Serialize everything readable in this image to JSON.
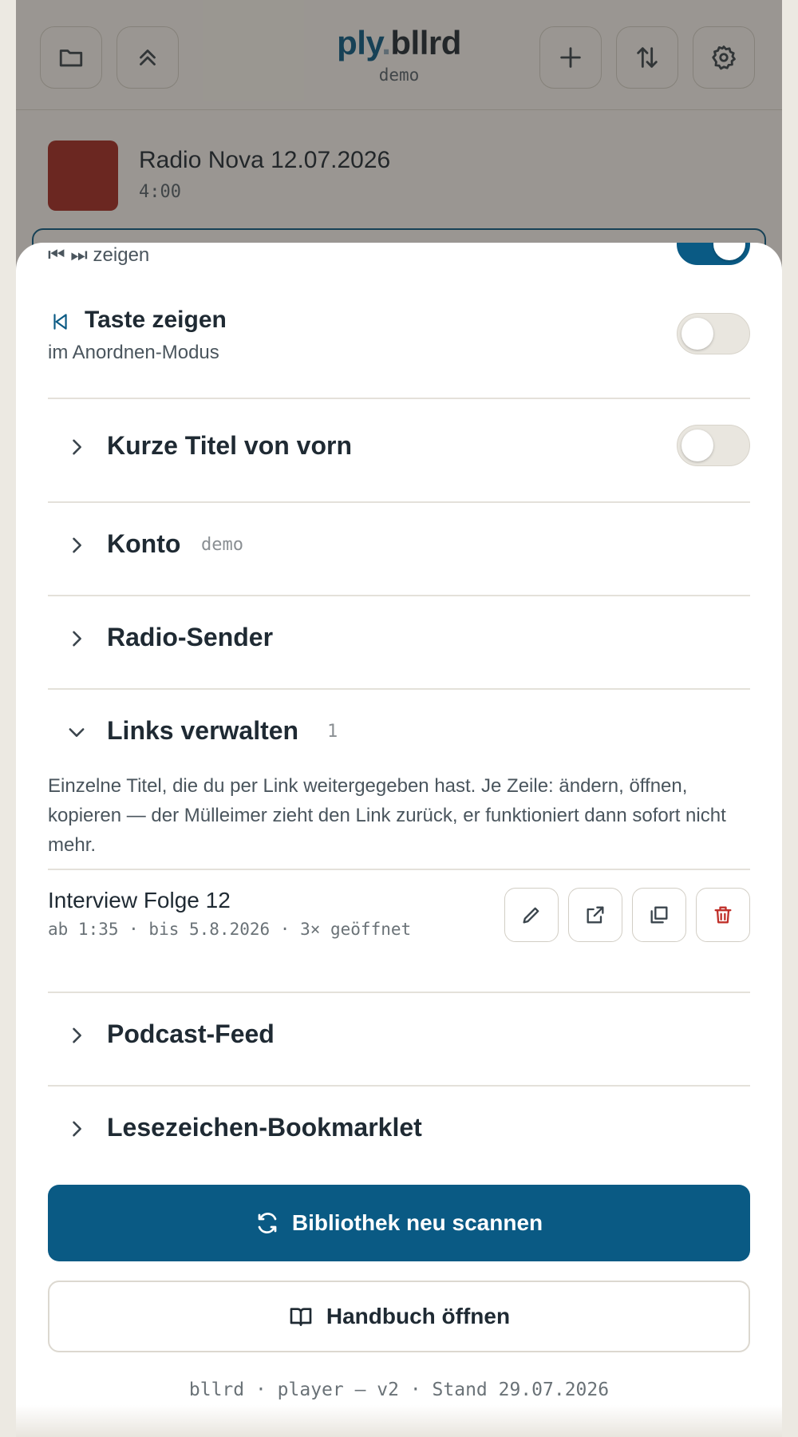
{
  "header": {
    "logo_part1": "ply",
    "logo_dot": ".",
    "logo_part2": "bllrd",
    "subtitle": "demo",
    "icons": [
      "folder-icon",
      "chevrons-up-icon",
      "plus-icon",
      "sort-arrows-icon",
      "gear-icon"
    ]
  },
  "track": {
    "title": "Radio Nova 12.07.2026",
    "duration": "4:00",
    "cover_color": "#a32a24"
  },
  "settings": {
    "skip_buttons": {
      "label": "⏮ ⏭ zeigen",
      "enabled": true
    },
    "taste": {
      "label": "Taste zeigen",
      "sublabel": "im Anordnen-Modus",
      "enabled": false
    },
    "sections": [
      {
        "label": "Kurze Titel von vorn",
        "has_toggle": true,
        "enabled": false
      },
      {
        "label": "Konto",
        "badge": "demo"
      },
      {
        "label": "Radio-Sender"
      },
      {
        "label": "Links verwalten",
        "badge": "1",
        "expanded": true
      },
      {
        "label": "Podcast-Feed"
      },
      {
        "label": "Lesezeichen-Bookmarklet"
      }
    ]
  },
  "links": {
    "description": "Einzelne Titel, die du per Link weitergegeben hast. Je Zeile: ändern, öffnen, kopieren — der Mülleimer zieht den Link zurück, er funktioniert dann sofort nicht mehr.",
    "items": [
      {
        "title": "Interview Folge 12",
        "meta": "ab 1:35 · bis 5.8.2026 · 3× geöffnet"
      }
    ]
  },
  "actions": {
    "rescan_label": "Bibliothek neu scannen",
    "manual_label": "Handbuch öffnen"
  },
  "footer": {
    "text": "bllrd · player — v2 · Stand 29.07.2026"
  },
  "colors": {
    "accent": "#0a5a84",
    "danger": "#c0302a",
    "background": "#ece9e2"
  }
}
